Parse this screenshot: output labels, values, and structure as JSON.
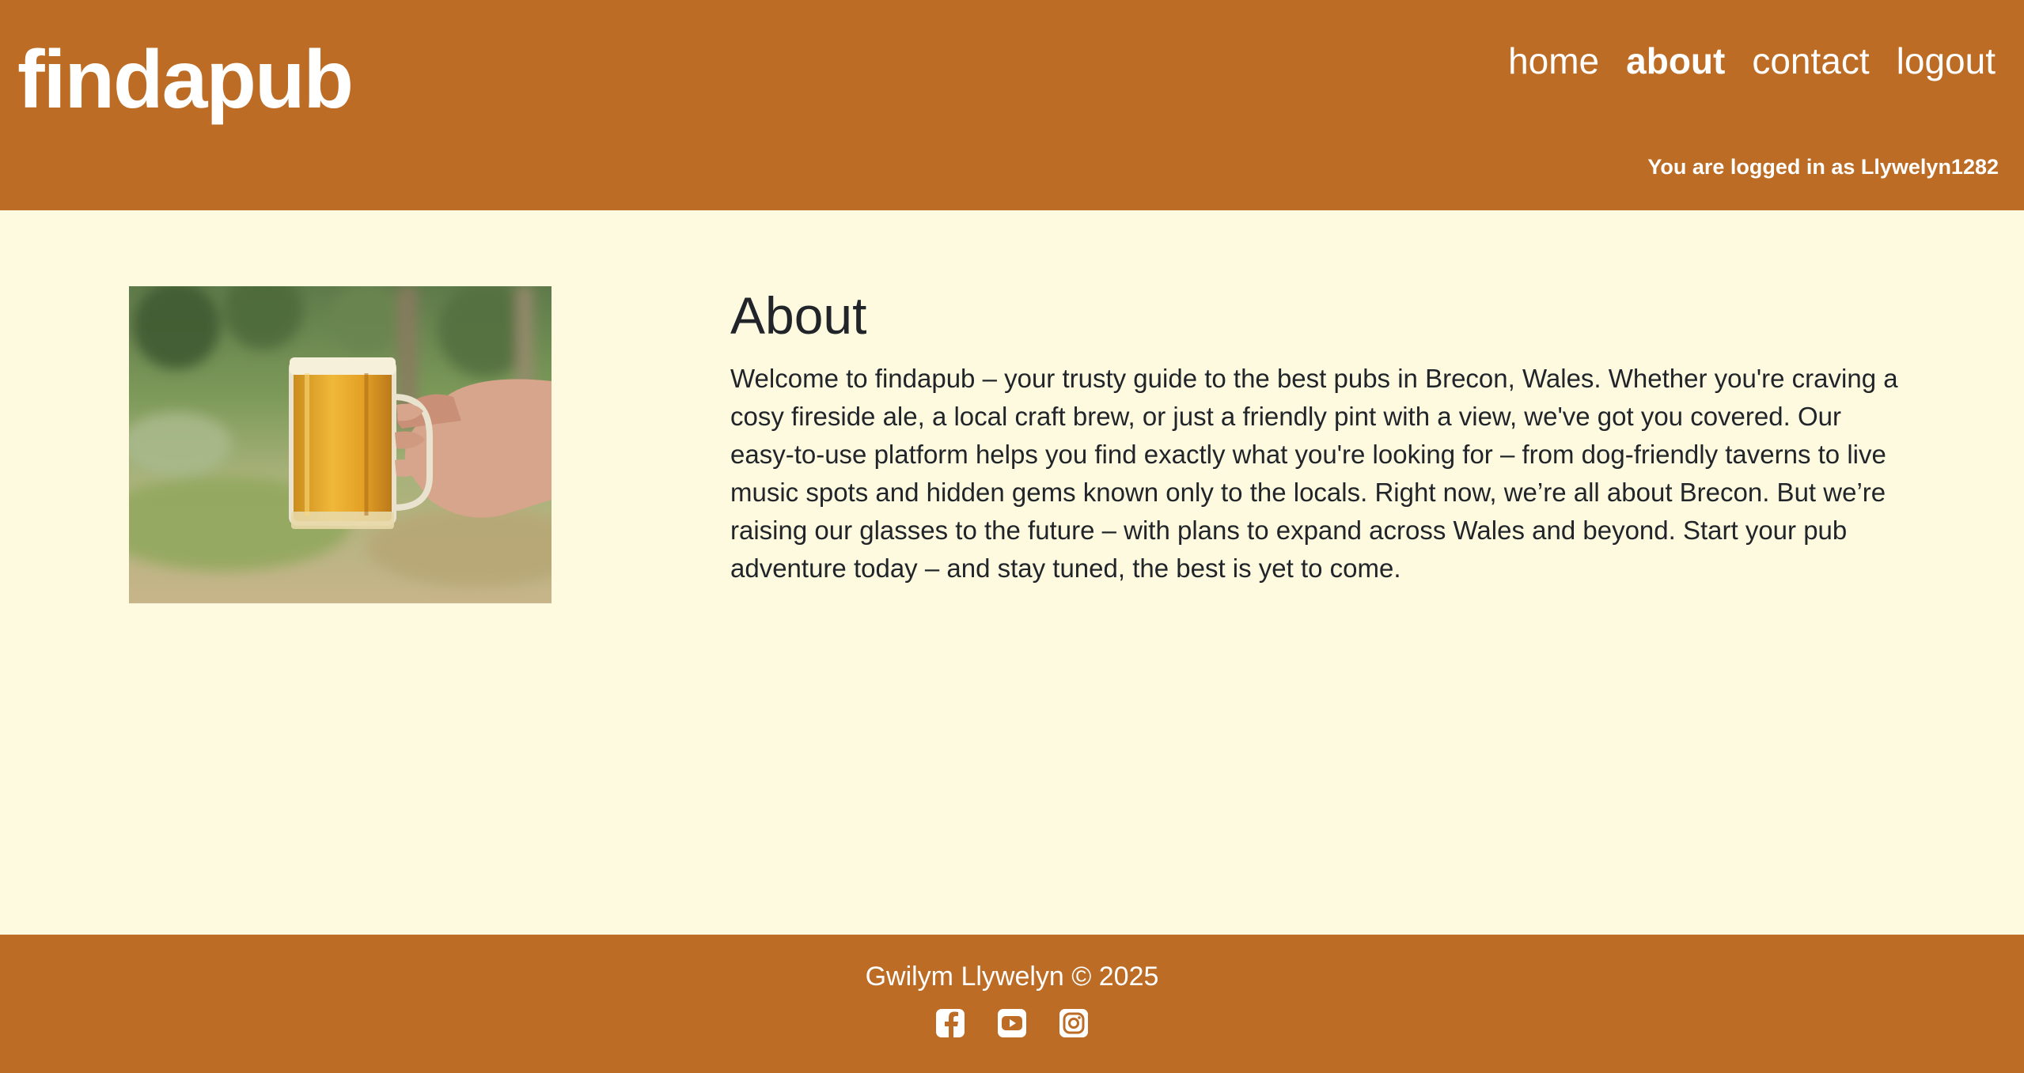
{
  "header": {
    "logo": "findapub",
    "nav": [
      {
        "label": "home",
        "active": false
      },
      {
        "label": "about",
        "active": true
      },
      {
        "label": "contact",
        "active": false
      },
      {
        "label": "logout",
        "active": false
      }
    ],
    "login_status": "You are logged in as Llywelyn1282"
  },
  "main": {
    "image": {
      "icon": "beer-mug-photo"
    },
    "title": "About",
    "body": "Welcome to findapub – your trusty guide to the best pubs in Brecon, Wales. Whether you're craving a cosy fireside ale, a local craft brew, or just a friendly pint with a view, we've got you covered. Our easy-to-use platform helps you find exactly what you're looking for – from dog-friendly taverns to live music spots and hidden gems known only to the locals. Right now, we’re all about Brecon. But we’re raising our glasses to the future – with plans to expand across Wales and beyond. Start your pub adventure today – and stay tuned, the best is yet to come."
  },
  "footer": {
    "copyright": "Gwilym Llywelyn © 2025",
    "socials": [
      "facebook-icon",
      "youtube-icon",
      "instagram-icon"
    ]
  },
  "colors": {
    "brand": "#BC6C25",
    "background": "#FEFAE0",
    "text": "#212529"
  }
}
